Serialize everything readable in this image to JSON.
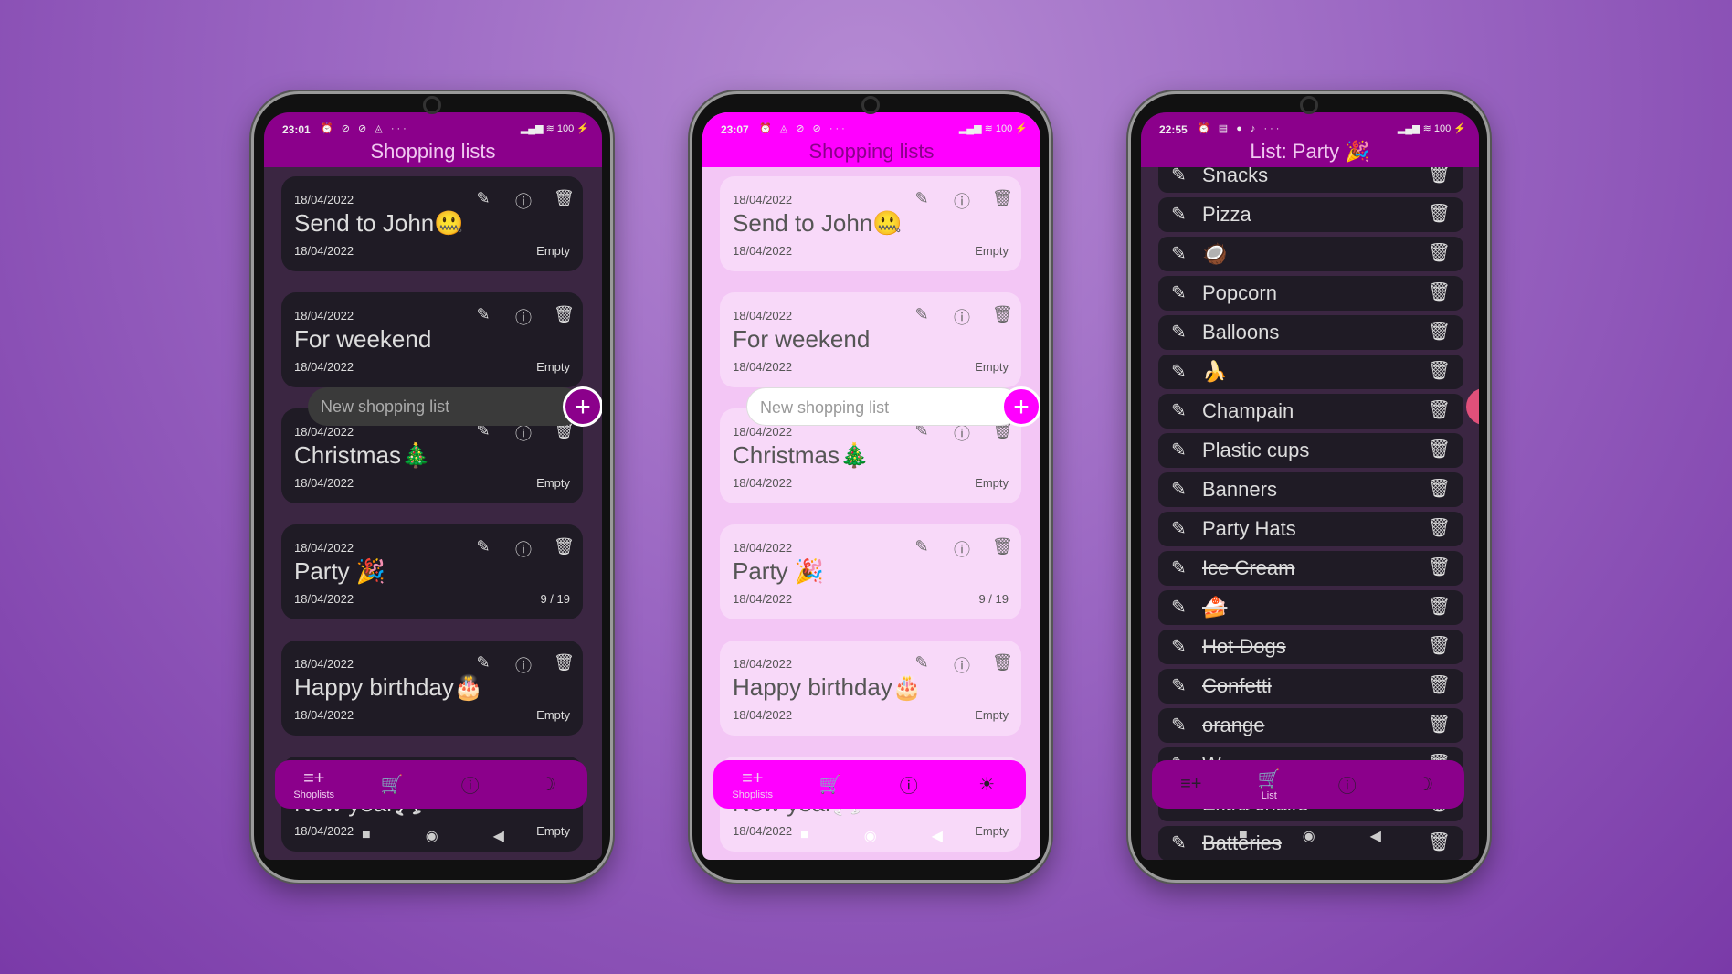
{
  "phones": [
    {
      "theme": "dark",
      "status_time": "23:01",
      "status_icons_left": "⏰ ⊘ ⊘ ◬ ···",
      "status_icons_right": "▂▄▆ ≋ 100 ⚡",
      "title": "Shopping lists",
      "cards": [
        {
          "date": "18/04/2022",
          "title": "Send to John🤐",
          "date2": "18/04/2022",
          "status": "Empty"
        },
        {
          "date": "18/04/2022",
          "title": "For weekend",
          "date2": "18/04/2022",
          "status": "Empty"
        },
        {
          "date": "18/04/2022",
          "title": "Christmas🎄",
          "date2": "18/04/2022",
          "status": "Empty"
        },
        {
          "date": "18/04/2022",
          "title": "Party 🎉",
          "date2": "18/04/2022",
          "status": "9 / 19"
        },
        {
          "date": "18/04/2022",
          "title": "Happy birthday🎂",
          "date2": "18/04/2022",
          "status": "Empty"
        },
        {
          "date": "",
          "title": "New year🥂",
          "date2": "18/04/2022",
          "status": "Empty"
        }
      ],
      "new_list_placeholder": "New shopping list",
      "nav": [
        {
          "icon": "playlist-add-icon",
          "glyph": "≡+",
          "label": "Shoplists",
          "active": true
        },
        {
          "icon": "cart-add-icon",
          "glyph": "🛒",
          "label": "",
          "active": false
        },
        {
          "icon": "info-icon",
          "glyph": "ⓘ",
          "label": "",
          "active": false
        },
        {
          "icon": "moon-icon",
          "glyph": "☽",
          "label": "",
          "active": false
        }
      ]
    },
    {
      "theme": "light",
      "status_time": "23:07",
      "status_icons_left": "⏰ ◬ ⊘ ⊘ ···",
      "status_icons_right": "▂▄▆ ≋ 100 ⚡",
      "title": "Shopping lists",
      "cards": [
        {
          "date": "18/04/2022",
          "title": "Send to John🤐",
          "date2": "18/04/2022",
          "status": "Empty"
        },
        {
          "date": "18/04/2022",
          "title": "For weekend",
          "date2": "18/04/2022",
          "status": "Empty"
        },
        {
          "date": "18/04/2022",
          "title": "Christmas🎄",
          "date2": "18/04/2022",
          "status": "Empty"
        },
        {
          "date": "18/04/2022",
          "title": "Party 🎉",
          "date2": "18/04/2022",
          "status": "9 / 19"
        },
        {
          "date": "18/04/2022",
          "title": "Happy birthday🎂",
          "date2": "18/04/2022",
          "status": "Empty"
        },
        {
          "date": "",
          "title": "New year🥂",
          "date2": "18/04/2022",
          "status": "Empty"
        }
      ],
      "new_list_placeholder": "New shopping list",
      "nav": [
        {
          "icon": "playlist-add-icon",
          "glyph": "≡+",
          "label": "Shoplists",
          "active": true
        },
        {
          "icon": "cart-add-icon",
          "glyph": "🛒",
          "label": "",
          "active": false
        },
        {
          "icon": "info-icon",
          "glyph": "ⓘ",
          "label": "",
          "active": false
        },
        {
          "icon": "sun-icon",
          "glyph": "☀",
          "label": "",
          "active": false
        }
      ]
    },
    {
      "theme": "dark",
      "status_time": "22:55",
      "status_icons_left": "⏰ ▤ ● ♪ ···",
      "status_icons_right": "▂▄▆ ≋ 100 ⚡",
      "title": "List: Party 🎉",
      "items": [
        {
          "text": "Snacks",
          "done": false
        },
        {
          "text": "Pizza",
          "done": false
        },
        {
          "text": "🥥",
          "done": false
        },
        {
          "text": "Popcorn",
          "done": false
        },
        {
          "text": "Balloons",
          "done": false
        },
        {
          "text": "🍌",
          "done": false
        },
        {
          "text": "Champain",
          "done": false
        },
        {
          "text": "Plastic cups",
          "done": false
        },
        {
          "text": "Banners",
          "done": false
        },
        {
          "text": "Party Hats",
          "done": false
        },
        {
          "text": "Ice Cream",
          "done": true
        },
        {
          "text": "🍰",
          "done": true
        },
        {
          "text": "Hot Dogs",
          "done": true
        },
        {
          "text": "Confetti",
          "done": true
        },
        {
          "text": "orange",
          "done": true
        },
        {
          "text": "W",
          "done": false
        },
        {
          "text": "Extra chairs",
          "done": false
        },
        {
          "text": "Batteries",
          "done": true
        }
      ],
      "nav": [
        {
          "icon": "playlist-add-icon",
          "glyph": "≡+",
          "label": "",
          "active": false
        },
        {
          "icon": "cart-add-icon",
          "glyph": "🛒",
          "label": "List",
          "active": true
        },
        {
          "icon": "info-icon",
          "glyph": "ⓘ",
          "label": "",
          "active": false
        },
        {
          "icon": "moon-icon",
          "glyph": "☽",
          "label": "",
          "active": false
        }
      ]
    }
  ],
  "colors": {
    "dark_header": "#8b008b",
    "light_header": "#ff00ff",
    "dark_card": "#1f1b25",
    "light_card": "#f8d9f9"
  }
}
